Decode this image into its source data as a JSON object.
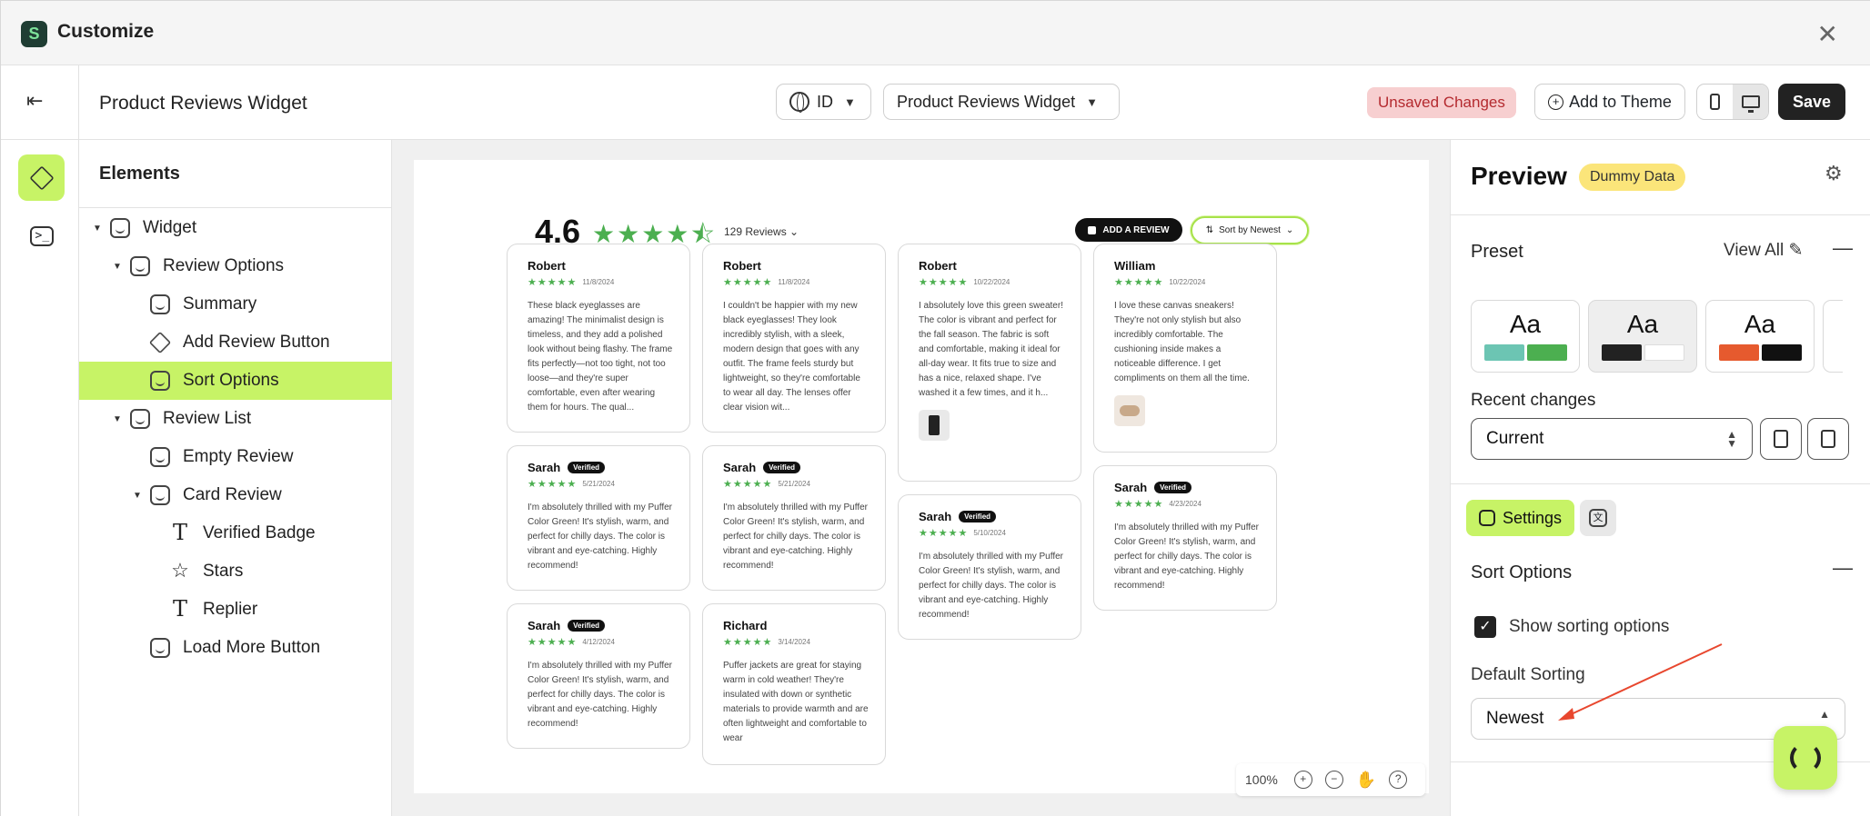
{
  "window": {
    "title": "Customize",
    "close_icon": "close-icon"
  },
  "header": {
    "page_title": "Product Reviews Widget",
    "language_select": "ID",
    "widget_select": "Product Reviews Widget",
    "unsaved_label": "Unsaved Changes",
    "add_to_theme_label": "Add to Theme",
    "save_label": "Save"
  },
  "elements_panel": {
    "title": "Elements",
    "tree": [
      {
        "label": "Widget",
        "level": 0,
        "caret": true,
        "icon": "widget-icon"
      },
      {
        "label": "Review Options",
        "level": 1,
        "caret": true,
        "icon": "section-icon"
      },
      {
        "label": "Summary",
        "level": 2,
        "caret": false,
        "icon": "section-icon"
      },
      {
        "label": "Add Review Button",
        "level": 2,
        "caret": false,
        "icon": "box-icon"
      },
      {
        "label": "Sort Options",
        "level": 2,
        "caret": false,
        "icon": "section-icon",
        "selected": true
      },
      {
        "label": "Review List",
        "level": 1,
        "caret": true,
        "icon": "section-icon"
      },
      {
        "label": "Empty Review",
        "level": 2,
        "caret": false,
        "icon": "section-icon"
      },
      {
        "label": "Card Review",
        "level": 2,
        "caret": true,
        "icon": "section-icon"
      },
      {
        "label": "Verified Badge",
        "level": 3,
        "caret": false,
        "icon": "text-icon"
      },
      {
        "label": "Stars",
        "level": 3,
        "caret": false,
        "icon": "star-icon"
      },
      {
        "label": "Replier",
        "level": 3,
        "caret": false,
        "icon": "text-icon"
      },
      {
        "label": "Load More Button",
        "level": 2,
        "caret": false,
        "icon": "section-icon"
      }
    ]
  },
  "preview_canvas": {
    "rating": "4.6",
    "reviews_count": "129 Reviews",
    "add_review_label": "ADD A REVIEW",
    "sort_label": "Sort by Newest",
    "zoom": "100%",
    "cards": [
      {
        "name": "Robert",
        "verified": false,
        "date": "11/8/2024",
        "body": "These black eyeglasses are amazing! The minimalist design is timeless, and they add a polished look without being flashy. The frame fits perfectly—not too tight, not too loose—and they're super comfortable, even after wearing them for hours. The qual...",
        "thumb": ""
      },
      {
        "name": "Robert",
        "verified": false,
        "date": "11/8/2024",
        "body": "I couldn't be happier with my new black eyeglasses! They look incredibly stylish, with a sleek, modern design that goes with any outfit. The frame feels sturdy but lightweight, so they're comfortable to wear all day. The lenses offer clear vision wit...",
        "thumb": ""
      },
      {
        "name": "Robert",
        "verified": false,
        "date": "10/22/2024",
        "body": "I absolutely love this green sweater! The color is vibrant and perfect for the fall season. The fabric is soft and comfortable, making it ideal for all-day wear. It fits true to size and has a nice, relaxed shape. I've washed it a few times, and it h...",
        "thumb": "item"
      },
      {
        "name": "William",
        "verified": false,
        "date": "10/22/2024",
        "body": "I love these canvas sneakers! They're not only stylish but also incredibly comfortable. The cushioning inside makes a noticeable difference. I get compliments on them all the time.",
        "thumb": "shoe"
      },
      {
        "name": "Sarah",
        "verified": true,
        "verified_label": "Verified",
        "date": "5/21/2024",
        "body": "I'm absolutely thrilled with my Puffer Color Green! It's stylish, warm, and perfect for chilly days. The color is vibrant and eye-catching. Highly recommend!",
        "thumb": ""
      },
      {
        "name": "Sarah",
        "verified": true,
        "verified_label": "Verified",
        "date": "5/21/2024",
        "body": "I'm absolutely thrilled with my Puffer Color Green! It's stylish, warm, and perfect for chilly days. The color is vibrant and eye-catching. Highly recommend!",
        "thumb": ""
      },
      {
        "name": "Sarah",
        "verified": true,
        "verified_label": "Verified",
        "date": "5/10/2024",
        "body": "I'm absolutely thrilled with my Puffer Color Green! It's stylish, warm, and perfect for chilly days. The color is vibrant and eye-catching. Highly recommend!",
        "thumb": ""
      },
      {
        "name": "Sarah",
        "verified": true,
        "verified_label": "Verified",
        "date": "4/23/2024",
        "body": "I'm absolutely thrilled with my Puffer Color Green! It's stylish, warm, and perfect for chilly days. The color is vibrant and eye-catching. Highly recommend!",
        "thumb": ""
      },
      {
        "name": "Sarah",
        "verified": true,
        "verified_label": "Verified",
        "date": "4/12/2024",
        "body": "I'm absolutely thrilled with my Puffer Color Green! It's stylish, warm, and perfect for chilly days. The color is vibrant and eye-catching. Highly recommend!",
        "thumb": ""
      },
      {
        "name": "Richard",
        "verified": false,
        "date": "3/14/2024",
        "body": "Puffer jackets are great for staying warm in cold weather! They're insulated with down or synthetic materials to provide warmth and are often lightweight and comfortable to wear",
        "thumb": ""
      }
    ]
  },
  "right_panel": {
    "title": "Preview",
    "badge": "Dummy Data",
    "preset_label": "Preset",
    "view_all_label": "View All",
    "presets": [
      {
        "label": "Aa",
        "colors": [
          "#6cc5b3",
          "#4caf50"
        ]
      },
      {
        "label": "Aa",
        "colors": [
          "#222222",
          "#ffffff"
        ]
      },
      {
        "label": "Aa",
        "colors": [
          "#e65a2e",
          "#111111"
        ]
      }
    ],
    "recent_changes_label": "Recent changes",
    "recent_changes_value": "Current",
    "settings_tab": "Settings",
    "sort_section_title": "Sort Options",
    "show_sorting_label": "Show sorting options",
    "show_sorting_checked": true,
    "default_sorting_label": "Default Sorting",
    "default_sorting_value": "Newest"
  },
  "colors": {
    "accent": "#c7f366",
    "star": "#4caf50",
    "unsaved_bg": "#f7cfd0",
    "unsaved_text": "#b42a2f",
    "badge": "#fbe57a",
    "annotation_arrow": "#e8472e"
  }
}
